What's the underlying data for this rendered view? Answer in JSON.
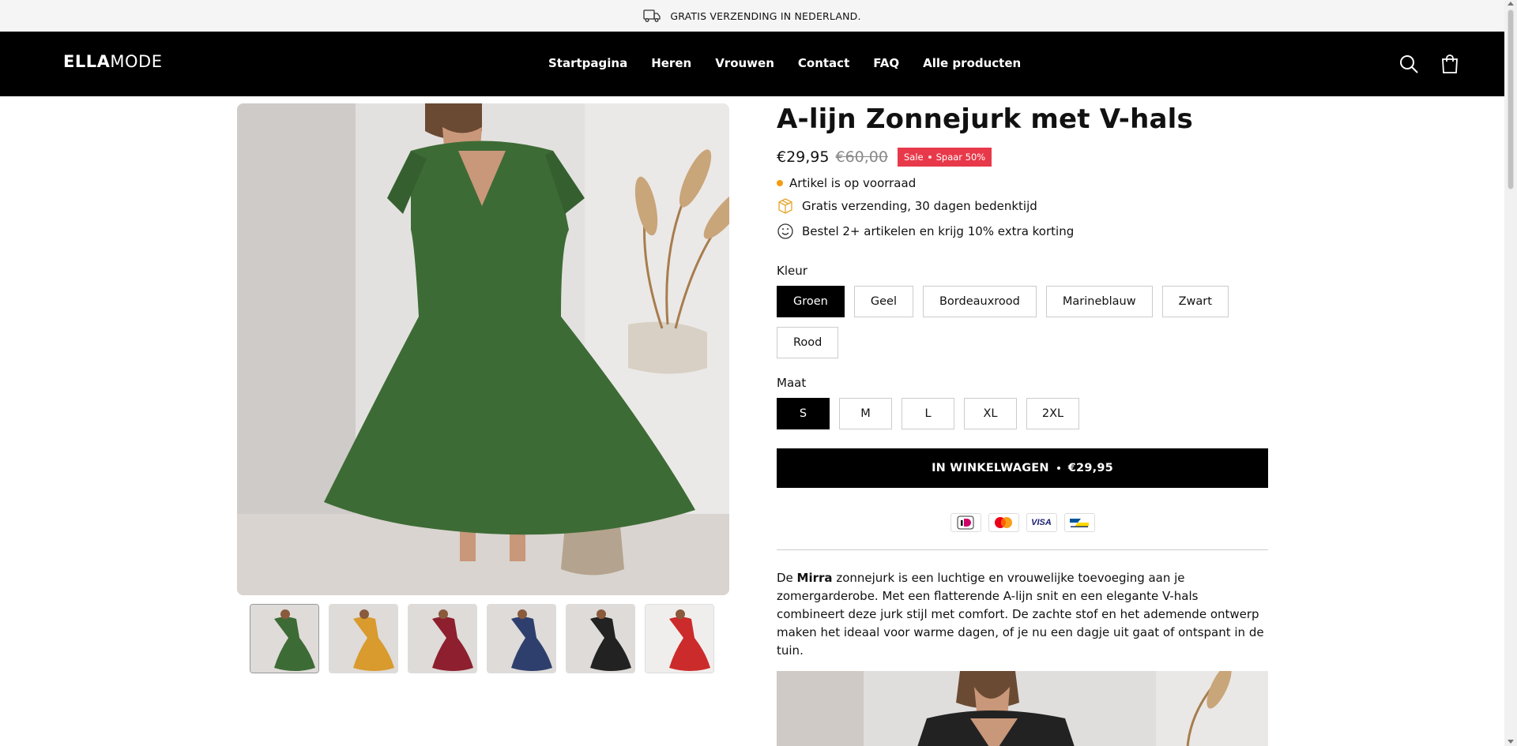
{
  "announcement": {
    "text": "GRATIS VERZENDING IN NEDERLAND.",
    "icon": "truck-icon"
  },
  "header": {
    "logo_bold": "ELLA",
    "logo_light": "MODE",
    "nav": [
      "Startpagina",
      "Heren",
      "Vrouwen",
      "Contact",
      "FAQ",
      "Alle producten"
    ],
    "icons": [
      "search-icon",
      "shopping-bag-icon"
    ]
  },
  "gallery": {
    "main_image": "green-dress",
    "thumbnail_colors": [
      "Groen",
      "Geel",
      "Bordeauxrood",
      "Marineblauw",
      "Zwart",
      "Rood"
    ]
  },
  "product": {
    "title": "A-lijn Zonnejurk met V-hals",
    "price": "€29,95",
    "compare_price": "€60,00",
    "badge_sale": "Sale",
    "badge_save": "Spaar 50%",
    "stock": "Artikel is op voorraad",
    "features": [
      {
        "icon": "box-icon",
        "text": "Gratis verzending, 30 dagen bedenktijd"
      },
      {
        "icon": "smiley-icon",
        "text": "Bestel 2+ artikelen en krijg 10% extra korting"
      }
    ],
    "color_label": "Kleur",
    "colors": [
      "Groen",
      "Geel",
      "Bordeauxrood",
      "Marineblauw",
      "Zwart",
      "Rood"
    ],
    "selected_color": "Groen",
    "size_label": "Maat",
    "sizes": [
      "S",
      "M",
      "L",
      "XL",
      "2XL"
    ],
    "selected_size": "S",
    "cart_label": "IN WINKELWAGEN",
    "cart_price": "€29,95",
    "payments": [
      "iDEAL",
      "Mastercard",
      "VISA",
      "Bancontact"
    ],
    "description": {
      "before": "De ",
      "bold": "Mirra",
      "after": " zonnejurk is een luchtige en vrouwelijke toevoeging aan je zomergarderobe. Met een flatterende A-lijn snit en een elegante V-hals combineert deze jurk stijl met comfort. De zachte stof en het ademende ontwerp maken het ideaal voor warme dagen, of je nu een dagje uit gaat of ontspant in de tuin."
    }
  },
  "colors": {
    "header_bg": "#000000",
    "announce_bg": "#f5f5f5",
    "sale_badge": "#e8394a",
    "stock_dot": "#f39c12",
    "dress_green": "#3d6b35",
    "dress_yellow": "#d99a2e",
    "dress_burgundy": "#8e1f2e",
    "dress_navy": "#2e3f6e",
    "dress_black": "#222222",
    "dress_red": "#cc2b2b"
  }
}
